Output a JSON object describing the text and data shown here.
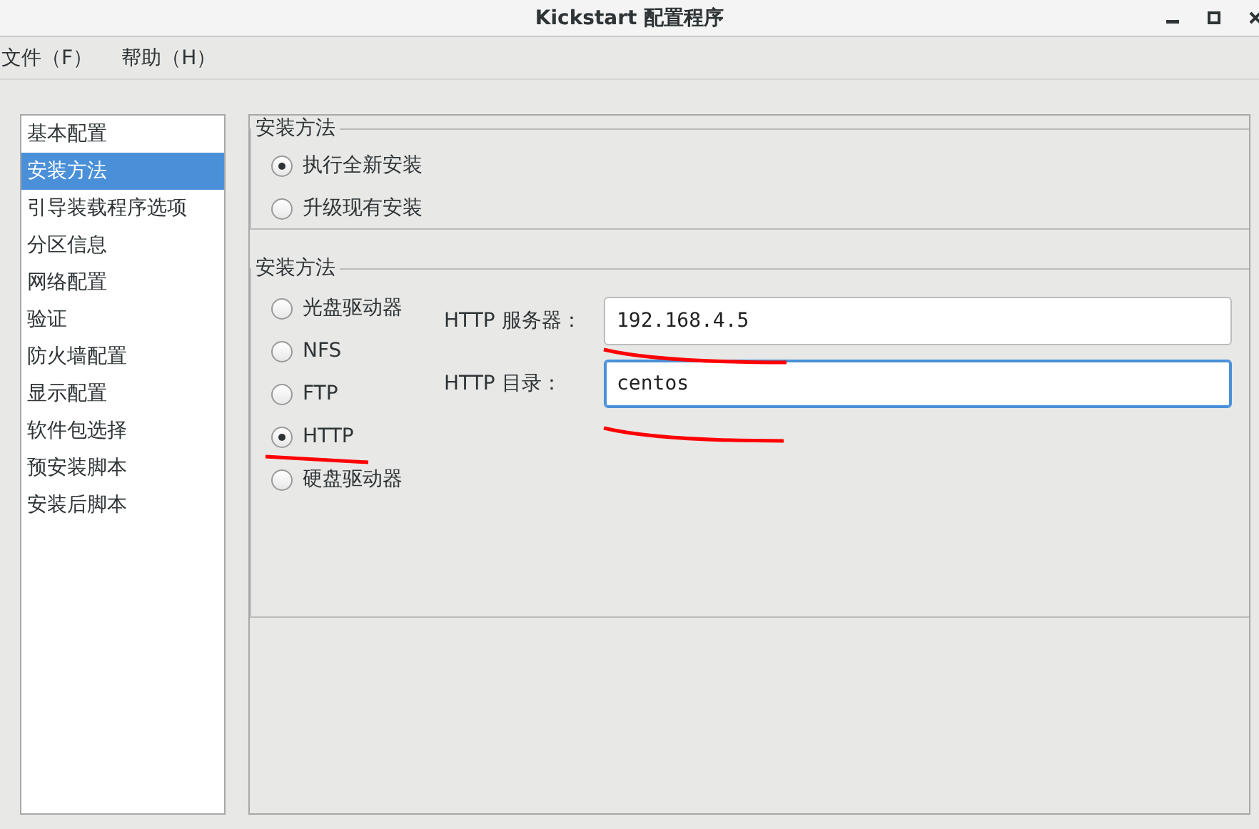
{
  "window": {
    "title": "Kickstart 配置程序"
  },
  "menu": [
    "文件（F）",
    "帮助（H）"
  ],
  "sidebar": {
    "items": [
      {
        "label": "基本配置",
        "selected": false
      },
      {
        "label": "安装方法",
        "selected": true
      },
      {
        "label": "引导装载程序选项",
        "selected": false
      },
      {
        "label": "分区信息",
        "selected": false
      },
      {
        "label": "网络配置",
        "selected": false
      },
      {
        "label": "验证",
        "selected": false
      },
      {
        "label": "防火墙配置",
        "selected": false
      },
      {
        "label": "显示配置",
        "selected": false
      },
      {
        "label": "软件包选择",
        "selected": false
      },
      {
        "label": "预安装脚本",
        "selected": false
      },
      {
        "label": "安装后脚本",
        "selected": false
      }
    ]
  },
  "install_type": {
    "title": "安装方法",
    "options": [
      {
        "label": "执行全新安装",
        "selected": true
      },
      {
        "label": "升级现有安装",
        "selected": false
      }
    ]
  },
  "install_method": {
    "title": "安装方法",
    "options": [
      {
        "label": "光盘驱动器",
        "selected": false
      },
      {
        "label": "NFS",
        "selected": false
      },
      {
        "label": "FTP",
        "selected": false
      },
      {
        "label": "HTTP",
        "selected": true
      },
      {
        "label": "硬盘驱动器",
        "selected": false
      }
    ],
    "fields": [
      {
        "label": "HTTP 服务器：",
        "value": "192.168.4.5",
        "focused": false
      },
      {
        "label": "HTTP 目录：",
        "value": "centos",
        "focused": true
      }
    ]
  }
}
